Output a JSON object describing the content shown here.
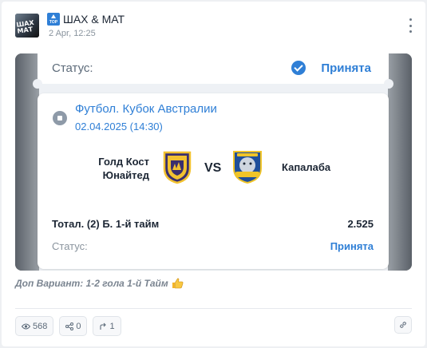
{
  "post": {
    "channel_badge": "TOP",
    "channel_name": "ШАХ & МАТ",
    "date": "2 Apr, 12:25",
    "avatar_text": "ШАХ МАТ"
  },
  "ticket": {
    "status_label": "Статус:",
    "status_value": "Принята",
    "league": "Футбол. Кубок Австралии",
    "match_date": "02.04.2025 (14:30)",
    "team1": "Голд Кост Юнайтед",
    "vs": "VS",
    "team2": "Капалаба",
    "bet_name": "Тотал. (2) Б. 1-й тайм",
    "odds": "2.525",
    "status_bottom_label": "Статус:",
    "status_bottom_value": "Принята"
  },
  "caption": "Доп Вариант: 1-2 гола 1-й Тайм",
  "actions": {
    "views": "568",
    "shares": "0",
    "forwards": "1"
  },
  "colors": {
    "accent": "#2f7fd6",
    "text": "#1c2634",
    "muted": "#8a949e"
  },
  "icons": [
    "top-badge-icon",
    "more-vertical-icon",
    "check-circle-icon",
    "soccer-ball-icon",
    "thumbs-up-icon",
    "eye-icon",
    "share-icon",
    "forward-icon",
    "link-icon"
  ]
}
